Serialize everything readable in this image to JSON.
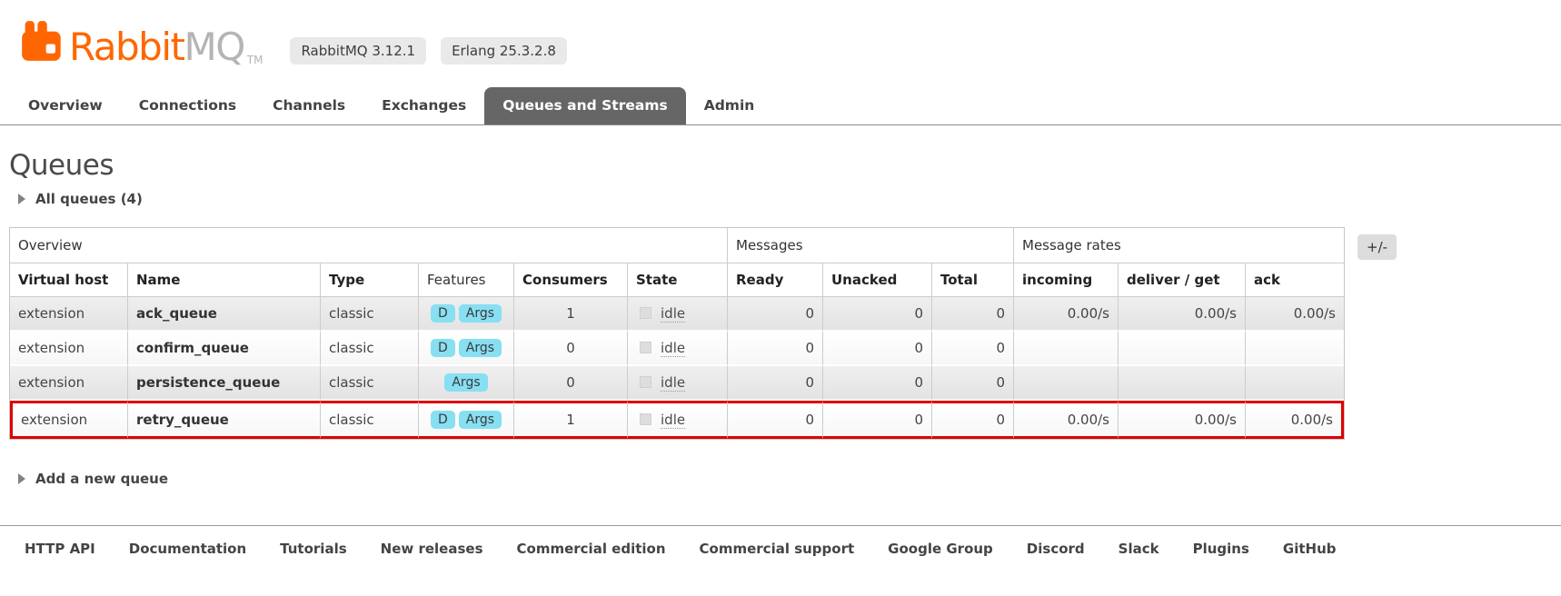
{
  "header": {
    "brand_rabbit": "Rabbit",
    "brand_mq": "MQ",
    "trademark": "TM",
    "badges": [
      "RabbitMQ 3.12.1",
      "Erlang 25.3.2.8"
    ]
  },
  "nav": {
    "tabs": [
      {
        "label": "Overview",
        "active": false
      },
      {
        "label": "Connections",
        "active": false
      },
      {
        "label": "Channels",
        "active": false
      },
      {
        "label": "Exchanges",
        "active": false
      },
      {
        "label": "Queues and Streams",
        "active": true
      },
      {
        "label": "Admin",
        "active": false
      }
    ]
  },
  "main": {
    "title": "Queues",
    "all_queues_label": "All queues (4)",
    "add_queue_label": "Add a new queue",
    "columns_button": "+/-"
  },
  "table": {
    "group_headers": [
      {
        "label": "Overview",
        "span": 6
      },
      {
        "label": "Messages",
        "span": 3
      },
      {
        "label": "Message rates",
        "span": 3
      }
    ],
    "columns": [
      "Virtual host",
      "Name",
      "Type",
      "Features",
      "Consumers",
      "State",
      "Ready",
      "Unacked",
      "Total",
      "incoming",
      "deliver / get",
      "ack"
    ],
    "rows": [
      {
        "virtual_host": "extension",
        "name": "ack_queue",
        "type": "classic",
        "features": [
          "D",
          "Args"
        ],
        "consumers": "1",
        "state": "idle",
        "ready": "0",
        "unacked": "0",
        "total": "0",
        "incoming": "0.00/s",
        "deliver_get": "0.00/s",
        "ack": "0.00/s",
        "highlighted": false
      },
      {
        "virtual_host": "extension",
        "name": "confirm_queue",
        "type": "classic",
        "features": [
          "D",
          "Args"
        ],
        "consumers": "0",
        "state": "idle",
        "ready": "0",
        "unacked": "0",
        "total": "0",
        "incoming": "",
        "deliver_get": "",
        "ack": "",
        "highlighted": false
      },
      {
        "virtual_host": "extension",
        "name": "persistence_queue",
        "type": "classic",
        "features": [
          "Args"
        ],
        "consumers": "0",
        "state": "idle",
        "ready": "0",
        "unacked": "0",
        "total": "0",
        "incoming": "",
        "deliver_get": "",
        "ack": "",
        "highlighted": false
      },
      {
        "virtual_host": "extension",
        "name": "retry_queue",
        "type": "classic",
        "features": [
          "D",
          "Args"
        ],
        "consumers": "1",
        "state": "idle",
        "ready": "0",
        "unacked": "0",
        "total": "0",
        "incoming": "0.00/s",
        "deliver_get": "0.00/s",
        "ack": "0.00/s",
        "highlighted": true
      }
    ]
  },
  "footer": {
    "links": [
      "HTTP API",
      "Documentation",
      "Tutorials",
      "New releases",
      "Commercial edition",
      "Commercial support",
      "Google Group",
      "Discord",
      "Slack",
      "Plugins",
      "GitHub"
    ]
  },
  "colors": {
    "brand_orange": "#ff6600",
    "feature_badge_bg": "#87dff2",
    "highlight_border": "#dd0000",
    "active_tab_bg": "#666666"
  }
}
